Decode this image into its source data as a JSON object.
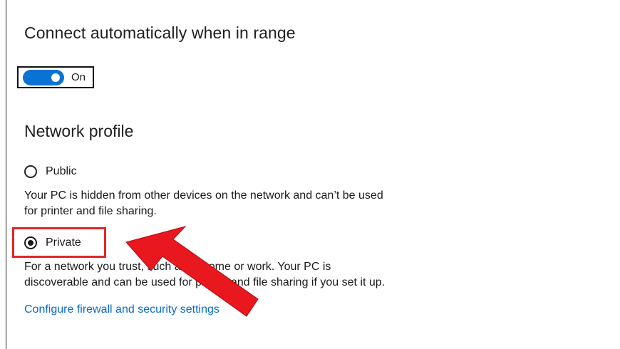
{
  "connect": {
    "title": "Connect automatically when in range",
    "toggle_state": "On",
    "toggle_on": true
  },
  "network_profile": {
    "title": "Network profile",
    "options": [
      {
        "label": "Public",
        "selected": false,
        "description_line1": "Your PC is hidden from other devices on the network and can’t be used",
        "description_line2": "for printer and file sharing."
      },
      {
        "label": "Private",
        "selected": true,
        "description_line1": "For a network you trust, such as at home or work. Your PC is",
        "description_line2": "discoverable and can be used for printer and file sharing if you set it up."
      }
    ]
  },
  "link": {
    "label": "Configure firewall and security settings"
  },
  "colors": {
    "accent": "#0a72d4",
    "link": "#0a6cc8",
    "highlight": "#e0252b"
  },
  "icons": {
    "annotation": "red-arrow-icon"
  }
}
